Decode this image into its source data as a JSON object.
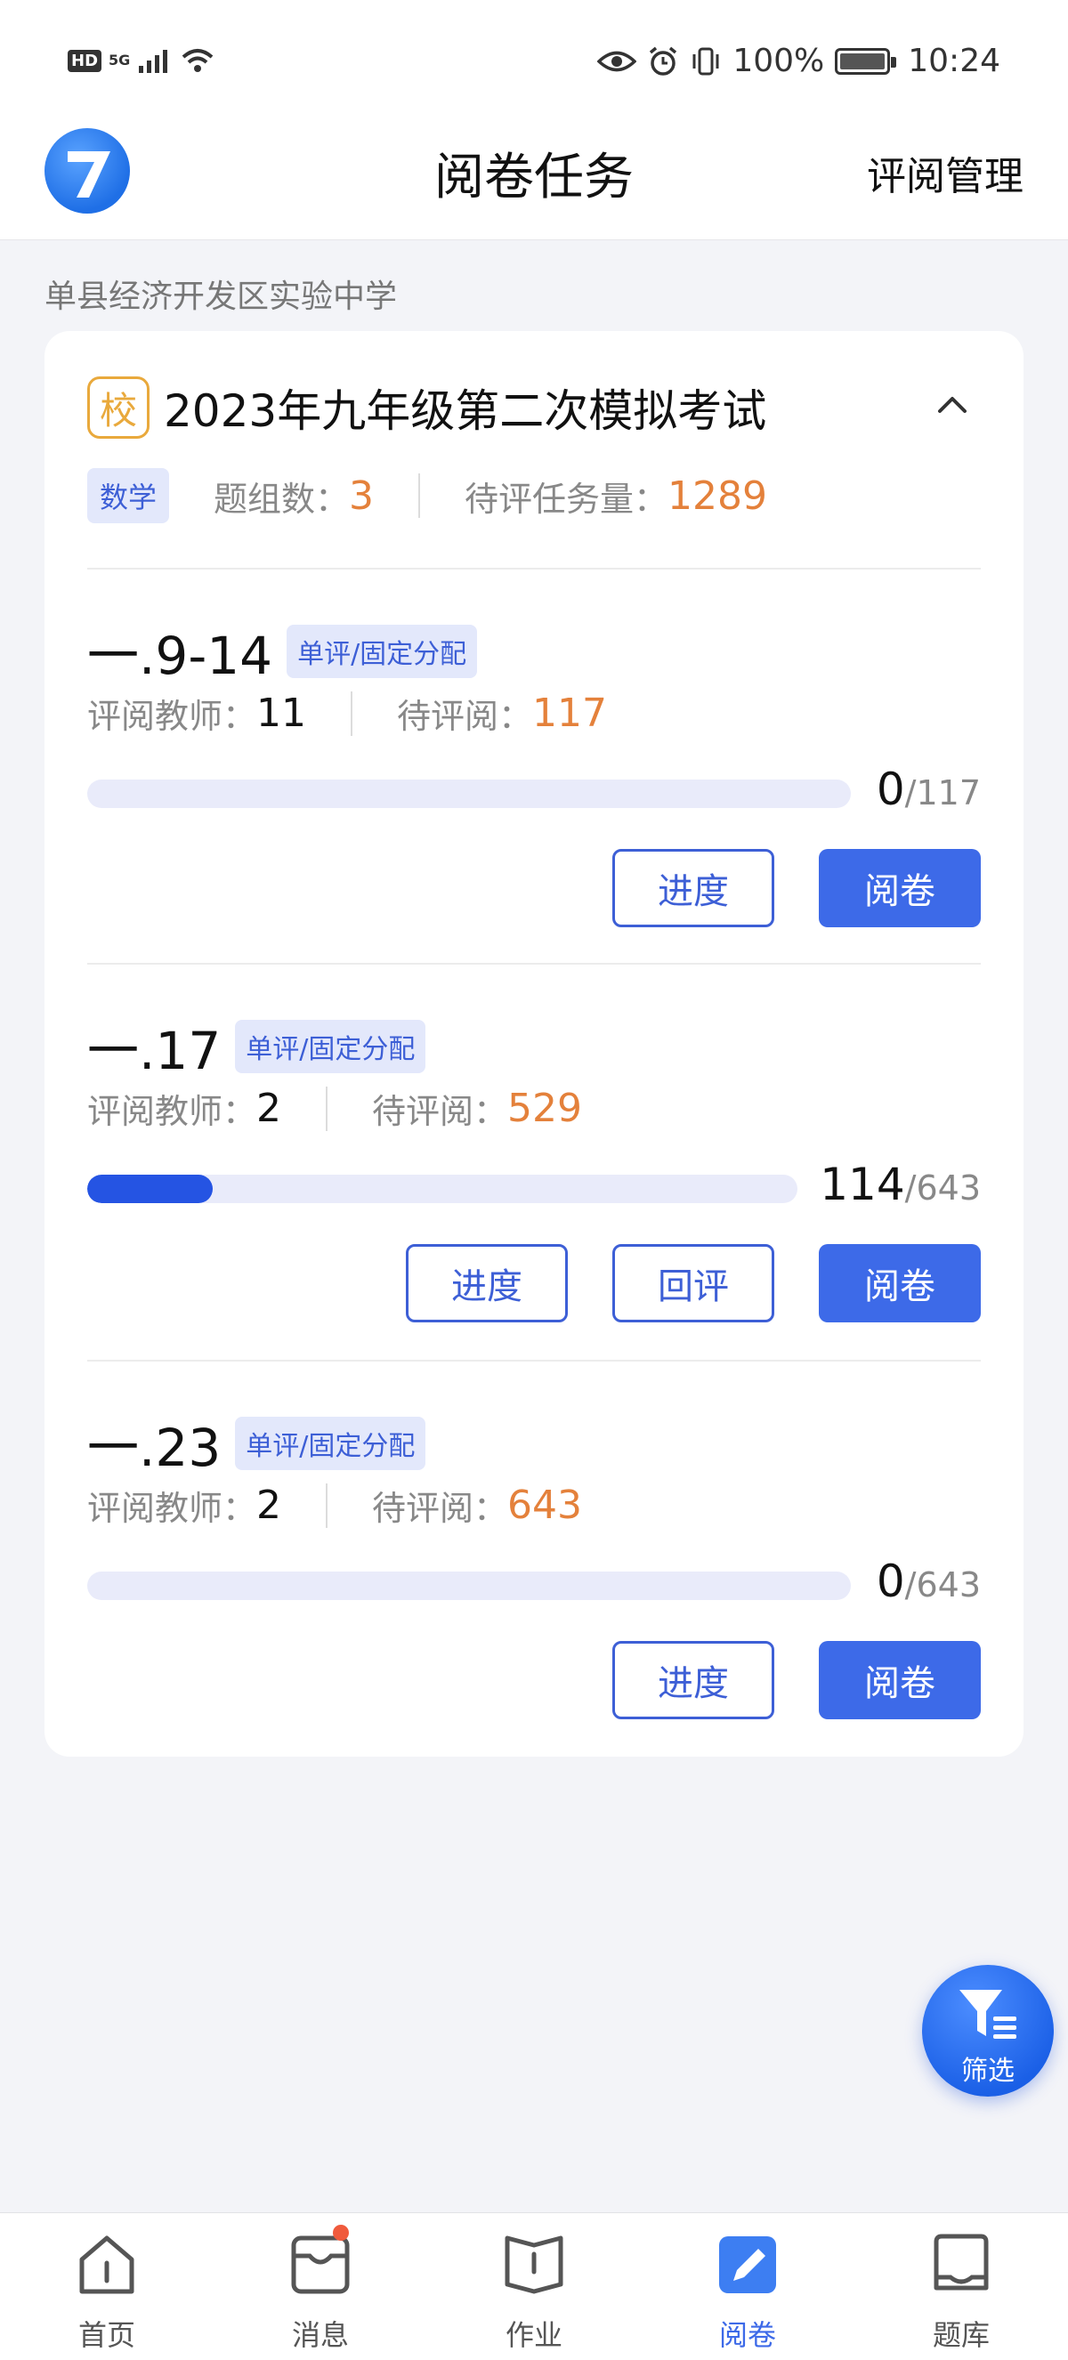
{
  "status_bar": {
    "left_badge": "HD",
    "network": "5G",
    "battery_percent": "100%",
    "time": "10:24"
  },
  "header": {
    "title": "阅卷任务",
    "action": "评阅管理"
  },
  "school_name": "单县经济开发区实验中学",
  "exam": {
    "badge": "校",
    "title": "2023年九年级第二次模拟考试",
    "subject": "数学",
    "group_count_label": "题组数：",
    "group_count": "3",
    "pending_total_label": "待评任务量：",
    "pending_total": "1289"
  },
  "tasks": [
    {
      "name": "一.9-14",
      "mode": "单评/固定分配",
      "teachers_label": "评阅教师：",
      "teachers": "11",
      "pending_label": "待评阅：",
      "pending": "117",
      "done": "0",
      "total": "/117",
      "progress": 0.0,
      "buttons": [
        "进度",
        "阅卷"
      ]
    },
    {
      "name": "一.17",
      "mode": "单评/固定分配",
      "teachers_label": "评阅教师：",
      "teachers": "2",
      "pending_label": "待评阅：",
      "pending": "529",
      "done": "114",
      "total": "/643",
      "progress": 0.177,
      "buttons": [
        "进度",
        "回评",
        "阅卷"
      ]
    },
    {
      "name": "一.23",
      "mode": "单评/固定分配",
      "teachers_label": "评阅教师：",
      "teachers": "2",
      "pending_label": "待评阅：",
      "pending": "643",
      "done": "0",
      "total": "/643",
      "progress": 0.0,
      "buttons": [
        "进度",
        "阅卷"
      ]
    }
  ],
  "filter_button": {
    "label": "筛选",
    "icon": "filter-icon"
  },
  "bottom_nav": [
    {
      "label": "首页",
      "icon": "home-icon"
    },
    {
      "label": "消息",
      "icon": "message-icon"
    },
    {
      "label": "作业",
      "icon": "homework-icon"
    },
    {
      "label": "阅卷",
      "icon": "grading-icon"
    },
    {
      "label": "题库",
      "icon": "question-bank-icon"
    }
  ],
  "colors": {
    "accent": "#3d6ae8",
    "progress": "#2554e3",
    "highlight": "#e4813b",
    "badge": "#e9a93c"
  }
}
